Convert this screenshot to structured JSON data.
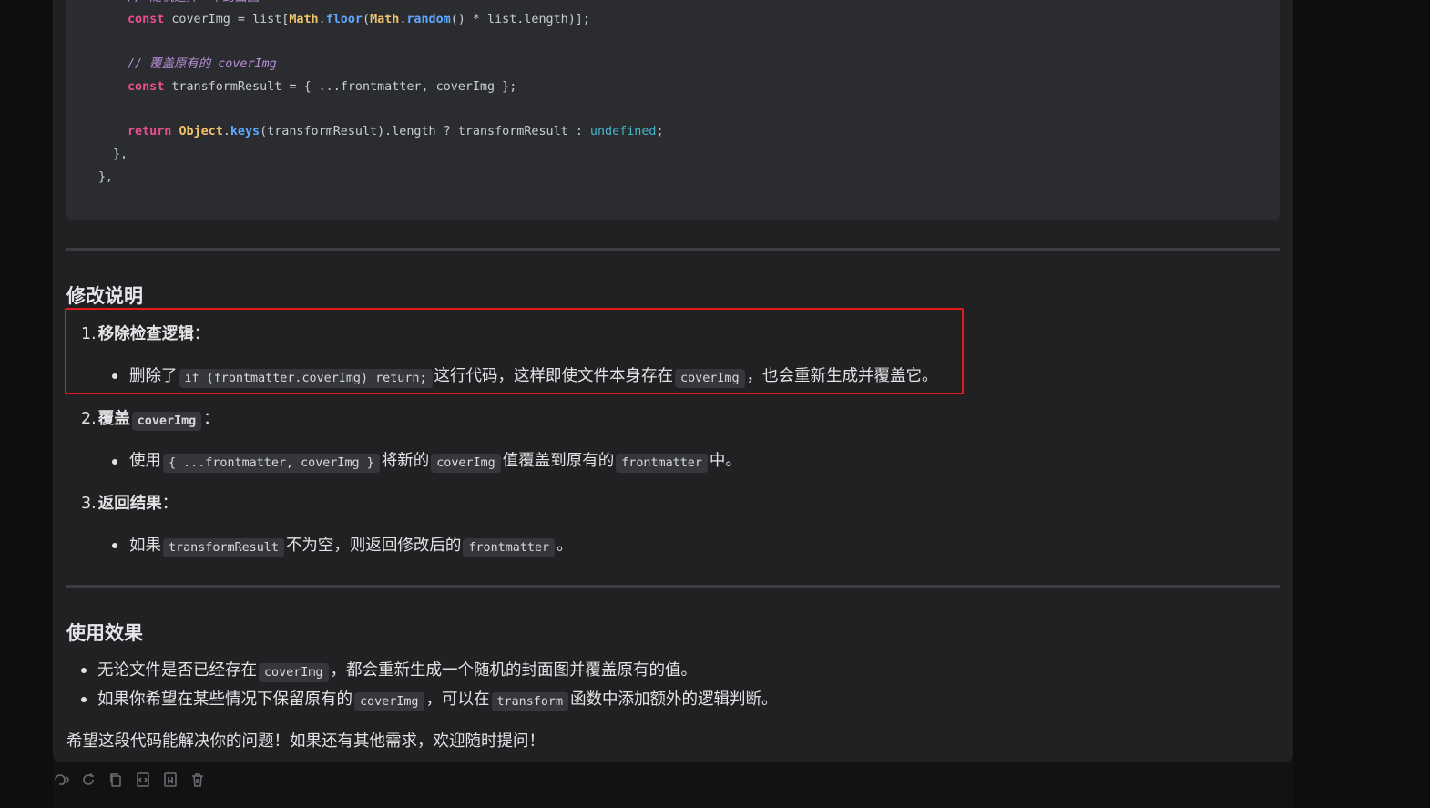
{
  "code": {
    "line1_comment": "// 随机选择一个封面图",
    "line2": {
      "kw": "const",
      "a": " coverImg = list[",
      "obj1": "Math",
      "dot1": ".",
      "fn1": "floor",
      "b": "(",
      "obj2": "Math",
      "dot2": ".",
      "fn2": "random",
      "c": "() * list.length)];"
    },
    "line3_comment": "// 覆盖原有的 coverImg",
    "line4": {
      "kw": "const",
      "rest": " transformResult = { ...frontmatter, coverImg };"
    },
    "line5": {
      "kw": "return",
      "sp": " ",
      "obj": "Object",
      "dot": ".",
      "fn": "keys",
      "a": "(transformResult).length ? transformResult : ",
      "und": "undefined",
      "end": ";"
    },
    "line6": "},",
    "line7": "},"
  },
  "section1": {
    "title": "修改说明",
    "item1": {
      "num": "1.",
      "title": "移除检查逻辑",
      "colon": "：",
      "b_pre": "删除了",
      "b_code1": "if (frontmatter.coverImg) return;",
      "b_mid": "这行代码，这样即使文件本身存在",
      "b_code2": "coverImg",
      "b_post": "，也会重新生成并覆盖它。"
    },
    "item2": {
      "num": "2.",
      "title": "覆盖",
      "code": "coverImg",
      "colon": "：",
      "b_pre": "使用",
      "b_code1": "{ ...frontmatter, coverImg }",
      "b_mid": "将新的",
      "b_code2": "coverImg",
      "b_mid2": "值覆盖到原有的",
      "b_code3": "frontmatter",
      "b_post": "中。"
    },
    "item3": {
      "num": "3.",
      "title": "返回结果",
      "colon": "：",
      "b_pre": "如果",
      "b_code1": "transformResult",
      "b_mid": "不为空，则返回修改后的",
      "b_code2": "frontmatter",
      "b_post": "。"
    }
  },
  "section2": {
    "title": "使用效果",
    "bullet1": {
      "pre": "无论文件是否已经存在",
      "code": "coverImg",
      "post": "，都会重新生成一个随机的封面图并覆盖原有的值。"
    },
    "bullet2": {
      "pre": "如果你希望在某些情况下保留原有的",
      "code1": "coverImg",
      "mid": "，可以在",
      "code2": "transform",
      "post": "函数中添加额外的逻辑判断。"
    }
  },
  "closing": "希望这段代码能解决你的问题！如果还有其他需求，欢迎随时提问！",
  "toolbar": {
    "icons": [
      "read-aloud-icon",
      "regenerate-icon",
      "copy-icon",
      "code-icon",
      "bookmark-icon",
      "delete-icon"
    ]
  },
  "colors": {
    "highlight_border": "#e01b1b",
    "keyword": "#ec4d8f",
    "builtin": "#f0c36a",
    "method": "#5fa8ff",
    "comment": "#b78fd6"
  }
}
